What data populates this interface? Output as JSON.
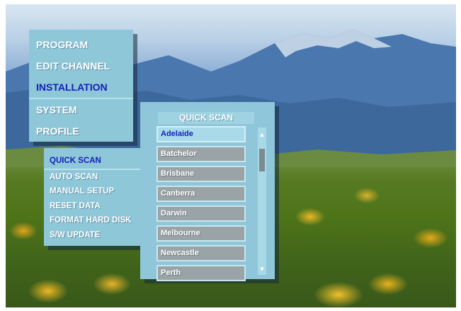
{
  "main_menu": {
    "items": [
      {
        "label": "PROGRAM"
      },
      {
        "label": "EDIT CHANNEL"
      },
      {
        "label": "INSTALLATION"
      },
      {
        "label": "SYSTEM"
      },
      {
        "label": "PROFILE"
      }
    ],
    "selected": "INSTALLATION"
  },
  "installation_menu": {
    "items": [
      {
        "label": "QUICK SCAN"
      },
      {
        "label": "AUTO SCAN"
      },
      {
        "label": "MANUAL SETUP"
      },
      {
        "label": "RESET DATA"
      },
      {
        "label": "FORMAT HARD DISK"
      },
      {
        "label": "S/W UPDATE"
      }
    ],
    "selected": "QUICK SCAN"
  },
  "quick_scan": {
    "title": "QUICK SCAN",
    "cities": [
      "Adelaide",
      "Batchelor",
      "Brisbane",
      "Canberra",
      "Darwin",
      "Melbourne",
      "Newcastle",
      "Perth"
    ],
    "selected": "Adelaide",
    "scroll_up_icon": "triangle-up-icon",
    "scroll_down_icon": "triangle-down-icon"
  },
  "colors": {
    "panel": "#8ec7d8",
    "highlight_text": "#1521b8",
    "list_row": "#9aa3a6"
  }
}
